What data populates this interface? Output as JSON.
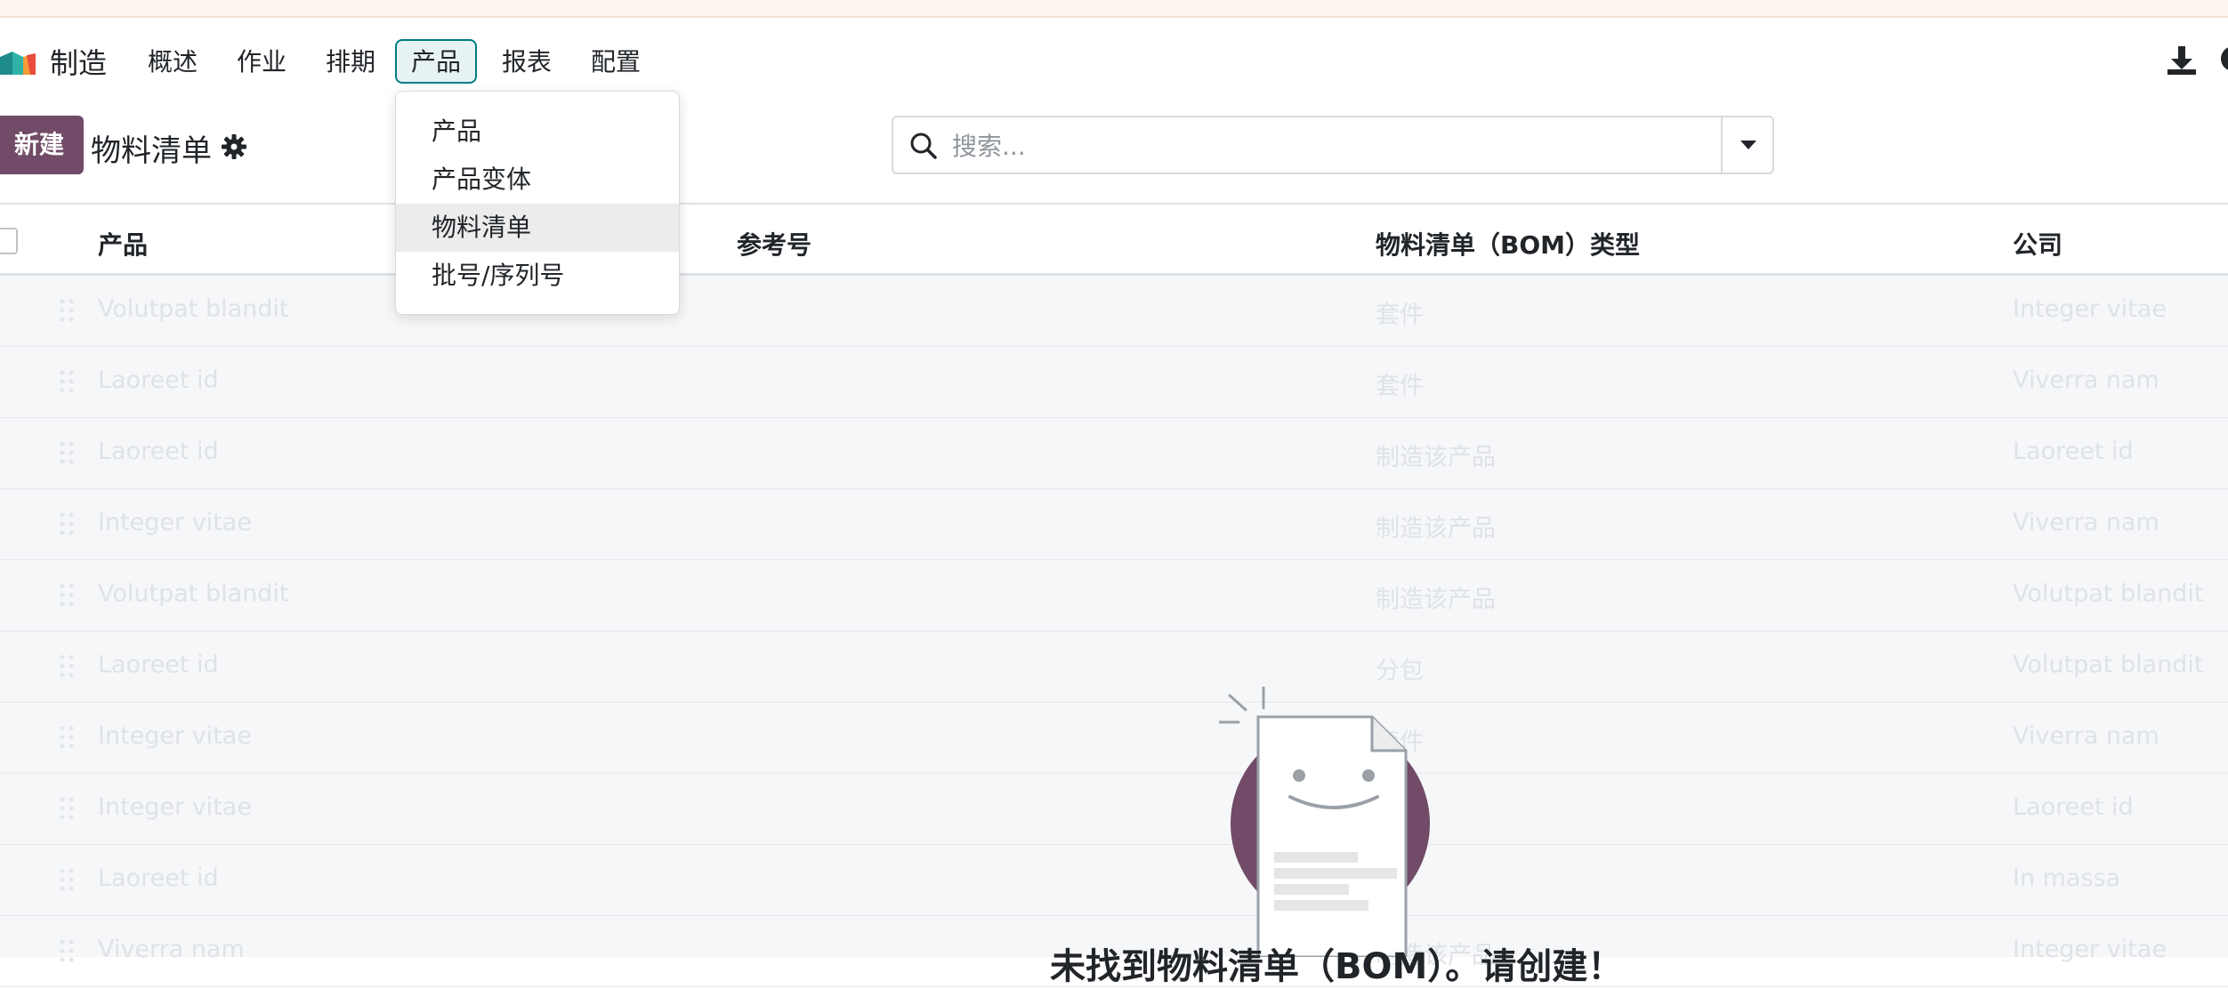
{
  "navbar": {
    "app_name": "制造",
    "menu": [
      {
        "label": "概述"
      },
      {
        "label": "作业"
      },
      {
        "label": "排期"
      },
      {
        "label": "产品",
        "active": true
      },
      {
        "label": "报表"
      },
      {
        "label": "配置"
      }
    ],
    "right_icons": [
      "download-icon"
    ]
  },
  "control": {
    "new_button": "新建",
    "title": "物料清单",
    "search_placeholder": "搜索..."
  },
  "dropdown": {
    "items": [
      {
        "label": "产品"
      },
      {
        "label": "产品变体"
      },
      {
        "label": "物料清单",
        "selected": true
      },
      {
        "label": "批号/序列号"
      }
    ]
  },
  "table": {
    "headers": [
      "产品",
      "参考号",
      "物料清单（BOM）类型",
      "公司"
    ],
    "rows": [
      [
        "Volutpat blandit",
        "",
        "套件",
        "Integer vitae"
      ],
      [
        "Laoreet id",
        "",
        "套件",
        "Viverra nam"
      ],
      [
        "Laoreet id",
        "",
        "制造该产品",
        "Laoreet id"
      ],
      [
        "Integer vitae",
        "",
        "制造该产品",
        "Viverra nam"
      ],
      [
        "Volutpat blandit",
        "",
        "制造该产品",
        "Volutpat blandit"
      ],
      [
        "Laoreet id",
        "",
        "分包",
        "Volutpat blandit"
      ],
      [
        "Integer vitae",
        "",
        "套件",
        "Viverra nam"
      ],
      [
        "Integer vitae",
        "",
        "",
        "Laoreet id"
      ],
      [
        "Laoreet id",
        "",
        "",
        "In massa"
      ],
      [
        "Viverra nam",
        "",
        "制造该产品",
        "Integer vitae"
      ]
    ]
  },
  "empty_state": {
    "title": "未找到物料清单（BOM）。请创建！"
  },
  "colors": {
    "primary": "#714b67",
    "accent": "#017e84"
  }
}
